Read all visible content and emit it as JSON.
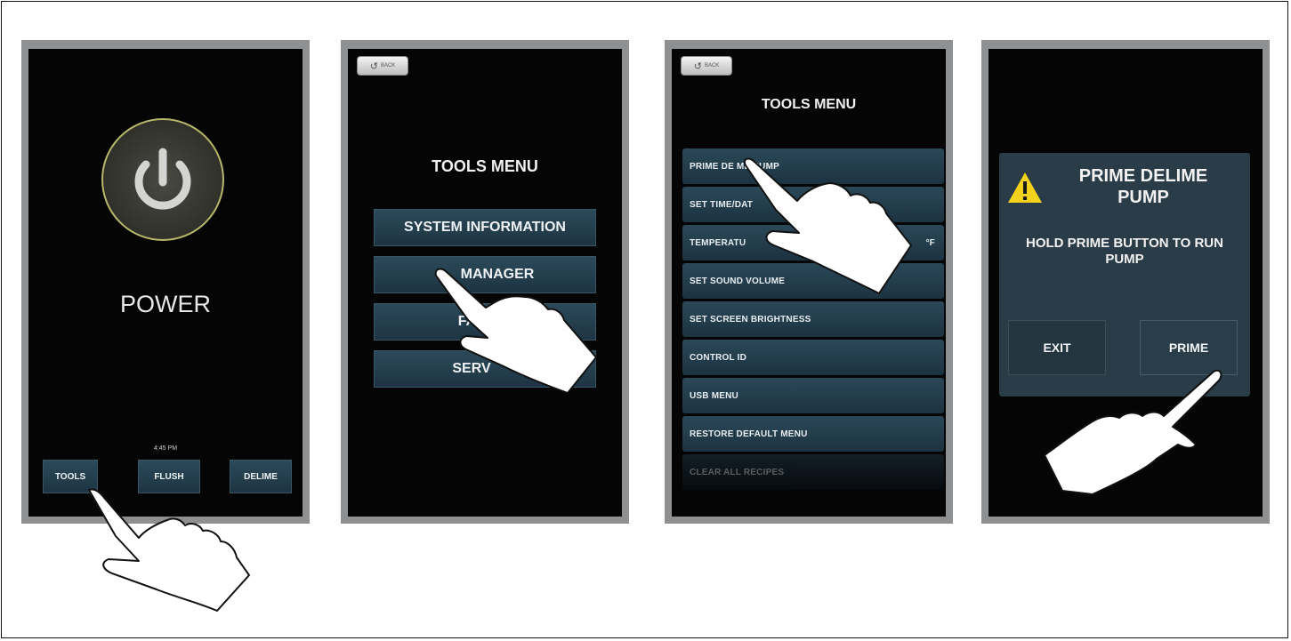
{
  "screen1": {
    "power_label": "POWER",
    "time": "4:45 PM",
    "buttons": {
      "tools": "TOOLS",
      "flush": "FLUSH",
      "delime": "DELIME"
    },
    "icon": "power-icon"
  },
  "screen2": {
    "back_label": "BACK",
    "title": "TOOLS MENU",
    "items": [
      "SYSTEM INFORMATION",
      "MANAGER",
      "FACTORY",
      "SERVICE"
    ],
    "visible_items": [
      "SYSTEM INFORMATION",
      "MANAGER",
      "FA",
      "SERV"
    ]
  },
  "screen3": {
    "back_label": "BACK",
    "title": "TOOLS MENU",
    "items": [
      "PRIME DELIME PUMP",
      "SET TIME/DATE",
      "TEMPERATURE",
      "SET SOUND VOLUME",
      "SET SCREEN BRIGHTNESS",
      "CONTROL ID",
      "USB MENU",
      "RESTORE DEFAULT MENU",
      "CLEAR ALL RECIPES"
    ],
    "visible_items": [
      "PRIME DE    ME PUMP",
      "SET TIME/DAT",
      "TEMPERATU",
      "SET SOUND VOLUME",
      "SET SCREEN BRIGHTNESS",
      "CONTROL ID",
      "USB MENU",
      "RESTORE DEFAULT MENU",
      "CLEAR ALL RECIPES"
    ],
    "temp_unit": "°F"
  },
  "screen4": {
    "dialog_title": "PRIME DELIME PUMP",
    "dialog_message": "HOLD PRIME BUTTON TO RUN PUMP",
    "exit_label": "EXIT",
    "prime_label": "PRIME",
    "warning_icon": "warning-icon",
    "warning_color": "#f2d21b"
  },
  "colors": {
    "button": "#2a4657",
    "power_ring": "#b7b76a",
    "screen_bg": "#050505"
  }
}
